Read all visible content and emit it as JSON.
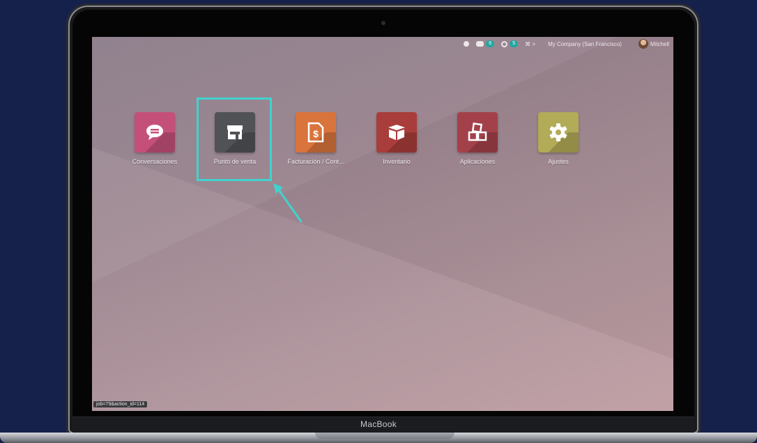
{
  "device": {
    "brand": "MacBook"
  },
  "topbar": {
    "chat_count": "6",
    "activity_count": "5",
    "shortcut": "⌘ >",
    "company": "My Company (San Francisco)",
    "user": "Mitchell"
  },
  "apps": [
    {
      "label": "Conversaciones",
      "icon": "chat-icon",
      "color": "#c4507a"
    },
    {
      "label": "Punto de venta",
      "icon": "store-icon",
      "color": "#515256"
    },
    {
      "label": "Facturación / Cont...",
      "icon": "invoice-icon",
      "color": "#d9743c"
    },
    {
      "label": "Inventario",
      "icon": "box-icon",
      "color": "#a93d3b"
    },
    {
      "label": "Aplicaciones",
      "icon": "cubes-icon",
      "color": "#a3414a"
    },
    {
      "label": "Ajustes",
      "icon": "gear-icon",
      "color": "#b2ab57"
    }
  ],
  "status_url": "job=79&action_id=114"
}
